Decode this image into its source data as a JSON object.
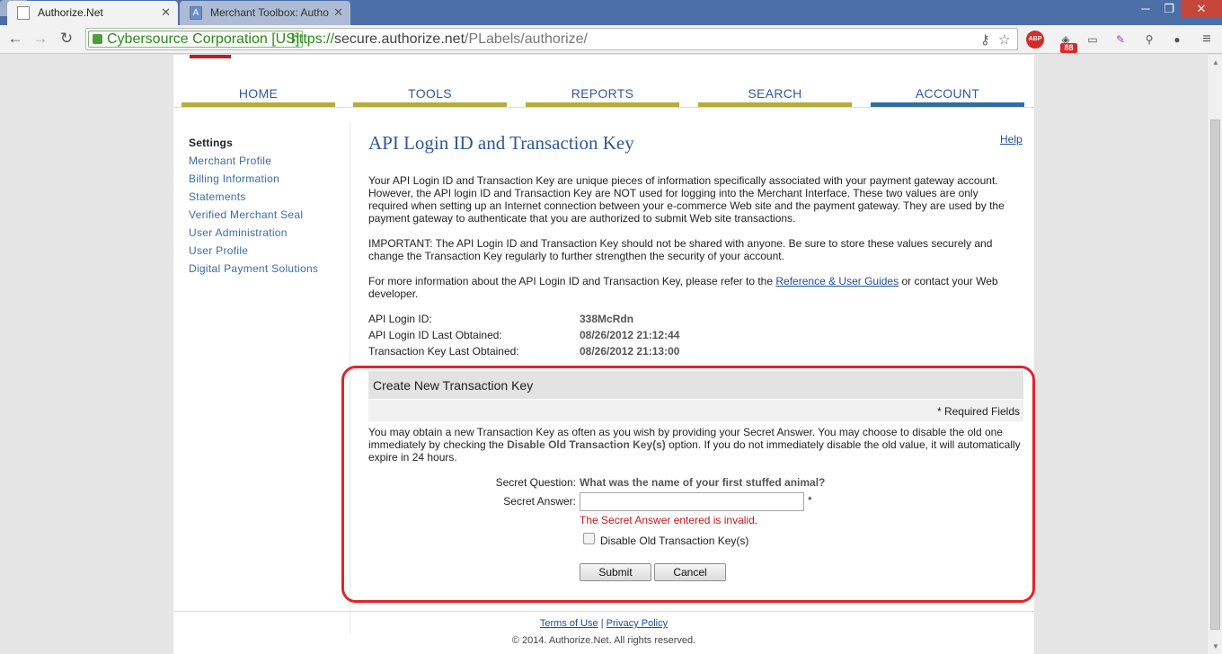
{
  "browser": {
    "tabs": [
      {
        "title": "Authorize.Net",
        "active": true
      },
      {
        "title": "Merchant Toolbox: Autho",
        "active": false
      }
    ],
    "omnibox": {
      "ev_label": "Cybersource Corporation [US]",
      "url_scheme": "https://",
      "url_host": "secure.authorize.net",
      "url_path": "/PLabels/authorize/"
    },
    "extension_badge": "88",
    "abp_label": "ABP",
    "icons": [
      "back-icon",
      "forward-icon",
      "reload-icon",
      "key-icon",
      "star-icon",
      "cast-icon",
      "feather-icon",
      "eyedropper-icon",
      "gear-icon",
      "menu-icon"
    ]
  },
  "site": {
    "topnav": [
      {
        "label": "HOME"
      },
      {
        "label": "TOOLS"
      },
      {
        "label": "REPORTS"
      },
      {
        "label": "SEARCH"
      },
      {
        "label": "ACCOUNT",
        "active": true
      }
    ],
    "sidebar": {
      "heading": "Settings",
      "items": [
        {
          "label": "Merchant Profile"
        },
        {
          "label": "Billing Information"
        },
        {
          "label": "Statements"
        },
        {
          "label": "Verified Merchant Seal"
        },
        {
          "label": "User Administration"
        },
        {
          "label": "User Profile"
        },
        {
          "label": "Digital Payment Solutions"
        }
      ]
    }
  },
  "main": {
    "title": "API Login ID and Transaction Key",
    "help_label": "Help",
    "intro": "Your API Login ID and Transaction Key are unique pieces of information specifically associated with your payment gateway account. However, the API login ID and Transaction Key are NOT used for logging into the Merchant Interface. These two values are only required when setting up an Internet connection between your e-commerce Web site and the payment gateway. They are used by the payment gateway to authenticate that you are authorized to submit Web site transactions.",
    "important": "IMPORTANT: The API Login ID and Transaction Key should not be shared with anyone. Be sure to store these values securely and change the Transaction Key regularly to further strengthen the security of your account.",
    "more_info_before": "For more information about the API Login ID and Transaction Key, please refer to the ",
    "more_info_link": "Reference & User Guides",
    "more_info_after": " or contact your Web developer.",
    "details": [
      {
        "label": "API Login ID:",
        "value": "338McRdn"
      },
      {
        "label": "API Login ID Last Obtained:",
        "value": "08/26/2012 21:12:44"
      },
      {
        "label": "Transaction Key Last Obtained:",
        "value": "08/26/2012 21:13:00"
      }
    ]
  },
  "new_key_panel": {
    "header": "Create New Transaction Key",
    "required_note": "* Required Fields",
    "description_before": "You may obtain a new Transaction Key as often as you wish by providing your Secret Answer. You may choose to disable the old one immediately by checking the ",
    "description_bold": "Disable Old Transaction Key(s)",
    "description_after": " option. If you do not immediately disable the old value, it will automatically expire in 24 hours.",
    "secret_question_label": "Secret Question:",
    "secret_question_value": "What was the name of your first stuffed animal?",
    "secret_answer_label": "Secret Answer:",
    "secret_answer_value": "",
    "required_marker": "*",
    "error": "The Secret Answer entered is invalid.",
    "disable_old_label": "Disable Old Transaction Key(s)",
    "disable_old_checked": false,
    "submit_label": "Submit",
    "cancel_label": "Cancel",
    "highlight_color": "#e0242d"
  },
  "footer": {
    "terms_label": "Terms of Use",
    "separator": "|",
    "privacy_label": "Privacy Policy",
    "copyright": "© 2014. Authorize.Net. All rights reserved."
  }
}
